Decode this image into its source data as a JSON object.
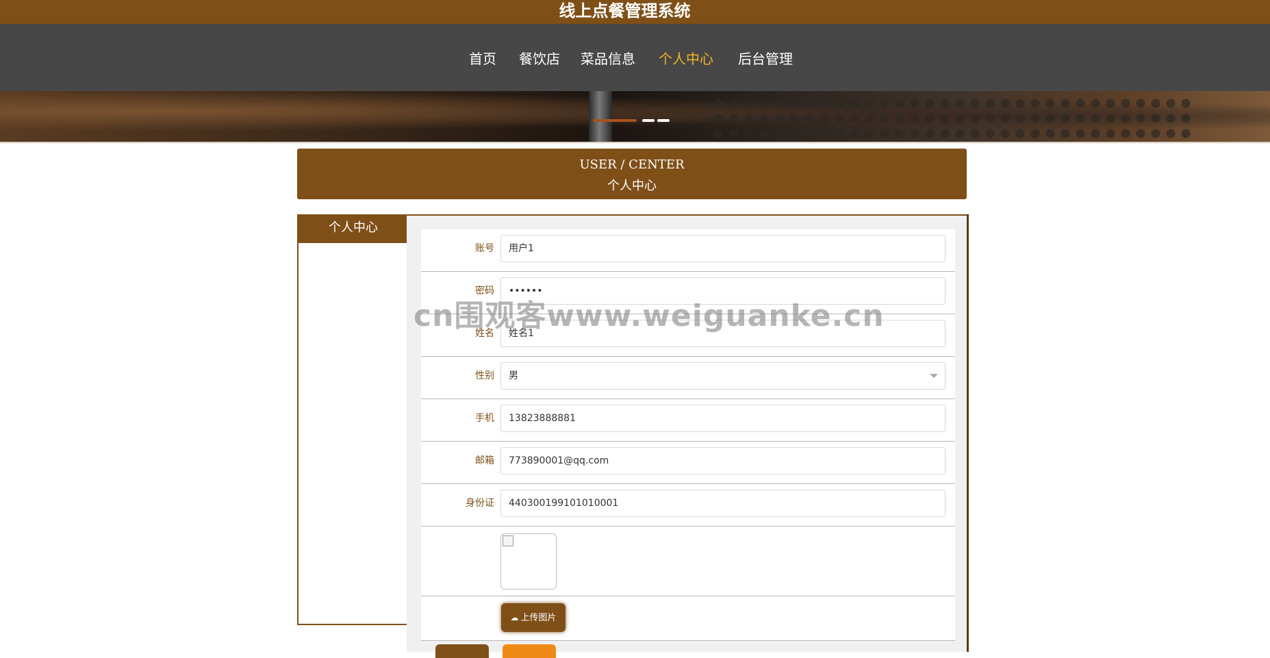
{
  "header": {
    "site_title": "线上点餐管理系统"
  },
  "nav": {
    "items": [
      {
        "label": "首页"
      },
      {
        "label": "餐饮店"
      },
      {
        "label": "菜品信息"
      },
      {
        "label": "个人中心",
        "active": true
      },
      {
        "label": "后台管理"
      }
    ]
  },
  "banner": {
    "slide_count": 3,
    "active_slide": 1
  },
  "section": {
    "title_en": "USER / CENTER",
    "title_cn": "个人中心"
  },
  "sidebar": {
    "title": "个人中心"
  },
  "form": {
    "account": {
      "label": "账号",
      "value": "用户1"
    },
    "password": {
      "label": "密码",
      "value": "••••••"
    },
    "name": {
      "label": "姓名",
      "value": "姓名1"
    },
    "gender": {
      "label": "性别",
      "value": "男"
    },
    "phone": {
      "label": "手机",
      "value": "13823888881"
    },
    "email": {
      "label": "邮箱",
      "value": "773890001@qq.com"
    },
    "id_card": {
      "label": "身份证",
      "value": "440300199101010001"
    },
    "upload_label": "上传图片"
  },
  "watermark": "cn围观客www.weiguanke.cn",
  "colors": {
    "brand": "#7f4f18",
    "nav_bg": "#474747",
    "active_nav": "#f1b623",
    "accent": "#f08a17"
  }
}
